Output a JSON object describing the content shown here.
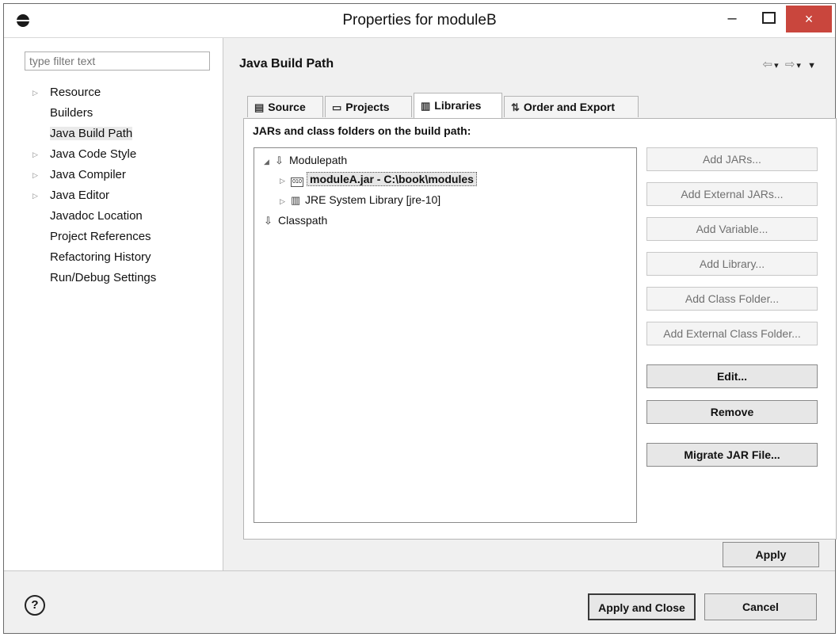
{
  "window": {
    "title": "Properties for moduleB",
    "minimize": "–",
    "close": "×"
  },
  "filter": {
    "placeholder": "type filter text"
  },
  "nav": [
    {
      "label": "Resource",
      "expandable": true
    },
    {
      "label": "Builders",
      "expandable": false
    },
    {
      "label": "Java Build Path",
      "expandable": false,
      "selected": true
    },
    {
      "label": "Java Code Style",
      "expandable": true
    },
    {
      "label": "Java Compiler",
      "expandable": true
    },
    {
      "label": "Java Editor",
      "expandable": true
    },
    {
      "label": "Javadoc Location",
      "expandable": false
    },
    {
      "label": "Project References",
      "expandable": false
    },
    {
      "label": "Refactoring History",
      "expandable": false
    },
    {
      "label": "Run/Debug Settings",
      "expandable": false
    }
  ],
  "page": {
    "title": "Java Build Path",
    "tabs": [
      {
        "label": "Source",
        "icon": "source-folder-icon"
      },
      {
        "label": "Projects",
        "icon": "projects-icon"
      },
      {
        "label": "Libraries",
        "icon": "libraries-icon",
        "active": true
      },
      {
        "label": "Order and Export",
        "icon": "order-export-icon"
      }
    ],
    "section_label": "JARs and class folders on the build path:",
    "tree": {
      "modulepath": "Modulepath",
      "jar": "moduleA.jar - C:\\book\\modules",
      "jre": "JRE System Library [jre-10]",
      "classpath": "Classpath"
    },
    "buttons": {
      "add_jars": "Add JARs...",
      "add_external_jars": "Add External JARs...",
      "add_variable": "Add Variable...",
      "add_library": "Add Library...",
      "add_class_folder": "Add Class Folder...",
      "add_external_class_folder": "Add External Class Folder...",
      "edit": "Edit...",
      "remove": "Remove",
      "migrate": "Migrate JAR File..."
    },
    "apply": "Apply"
  },
  "footer": {
    "help": "?",
    "apply_close": "Apply and Close",
    "cancel": "Cancel"
  },
  "colors": {
    "close_button": "#c9463d",
    "selection": "#e6e6e6"
  }
}
